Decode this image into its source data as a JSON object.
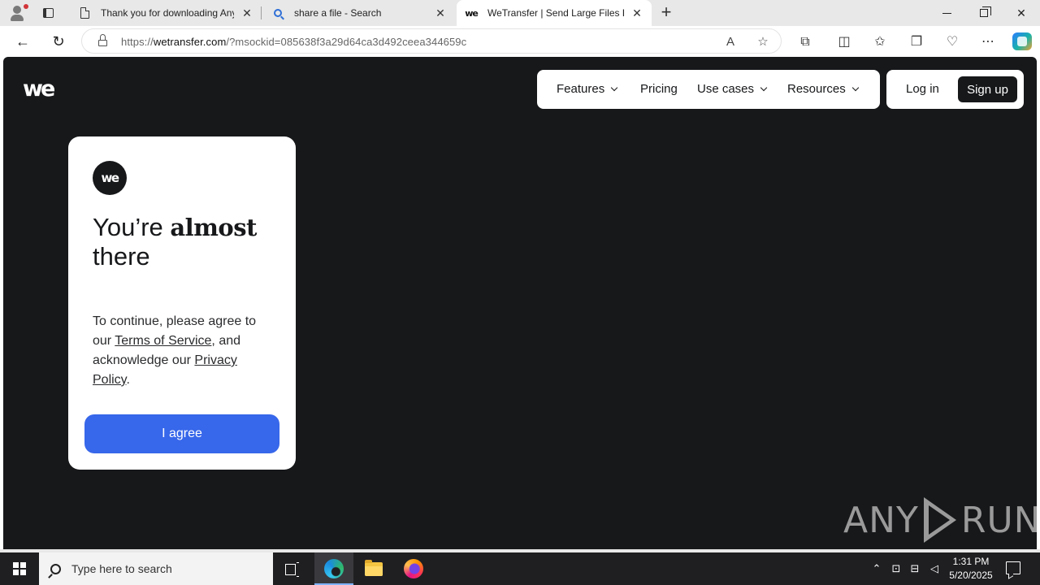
{
  "browser": {
    "tabs": [
      {
        "title": "Thank you for downloading AnyDesk",
        "icon": "document-icon"
      },
      {
        "title": "share a file - Search",
        "icon": "search-icon"
      },
      {
        "title": "WeTransfer | Send Large Files Fast",
        "icon": "wetransfer-icon"
      }
    ],
    "new_tab_glyph": "+",
    "url_prefix": "https://",
    "url_host": "wetransfer.com",
    "url_rest": "/?msockid=085638f3a29d64ca3d492ceea344659c"
  },
  "page": {
    "logo_text": "we",
    "nav": {
      "features": "Features",
      "pricing": "Pricing",
      "use_cases": "Use cases",
      "resources": "Resources",
      "login": "Log in",
      "signup": "Sign up"
    },
    "consent": {
      "logo_text": "we",
      "title_start": "You’re ",
      "title_bold": "almost",
      "title_end": " there",
      "text_1": "To continue, please agree to our ",
      "terms_link": "Terms of Service",
      "text_2": ", and acknowledge our ",
      "privacy_link": "Privacy Policy",
      "text_3": ".",
      "agree_button": "I agree"
    },
    "watermark": {
      "left": "ANY",
      "right": "RUN"
    }
  },
  "taskbar": {
    "search_placeholder": "Type here to search",
    "time": "1:31 PM",
    "date": "5/20/2025"
  },
  "colors": {
    "page_background": "#17181a",
    "agree_button": "#3767ea",
    "card_background": "#ffffff"
  }
}
